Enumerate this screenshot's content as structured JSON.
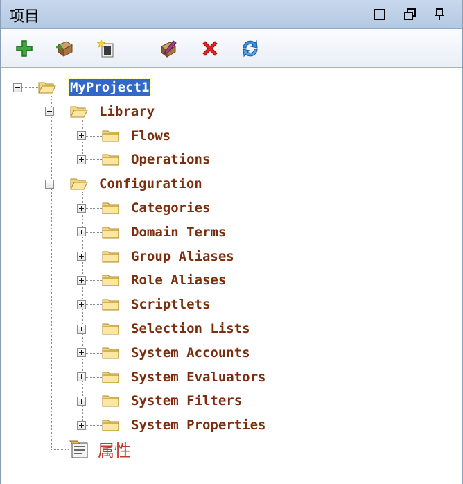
{
  "window": {
    "title": "项目",
    "buttons": [
      "maximize-icon",
      "restore-icon",
      "pin-icon"
    ]
  },
  "toolbar": {
    "buttons": [
      {
        "icon": "add-icon",
        "color": "#2e9b2e"
      },
      {
        "icon": "import-icon",
        "color": "#8b5a2b"
      },
      {
        "icon": "new-item-icon",
        "color": "#d9c9a0"
      },
      {
        "icon": "edit-icon",
        "color": "#8b4a7a"
      },
      {
        "icon": "delete-icon",
        "color": "#e02020"
      },
      {
        "icon": "refresh-icon",
        "color": "#2d7fd8"
      }
    ]
  },
  "tree": {
    "root": {
      "label": "MyProject1",
      "expanded": true,
      "selected": true
    },
    "library": {
      "label": "Library",
      "expanded": true,
      "children": [
        "Flows",
        "Operations"
      ]
    },
    "configuration": {
      "label": "Configuration",
      "expanded": true,
      "children": [
        "Categories",
        "Domain Terms",
        "Group Aliases",
        "Role Aliases",
        "Scriptlets",
        "Selection Lists",
        "System Accounts",
        "System Evaluators",
        "System Filters",
        "System Properties"
      ]
    },
    "properties": {
      "label": "属性",
      "icon": "properties-icon"
    }
  },
  "colors": {
    "label_text": "#7a2e0e",
    "selection": "#3168c9",
    "folder": "#f5d67a",
    "titlebar": "#c8d8ec"
  }
}
